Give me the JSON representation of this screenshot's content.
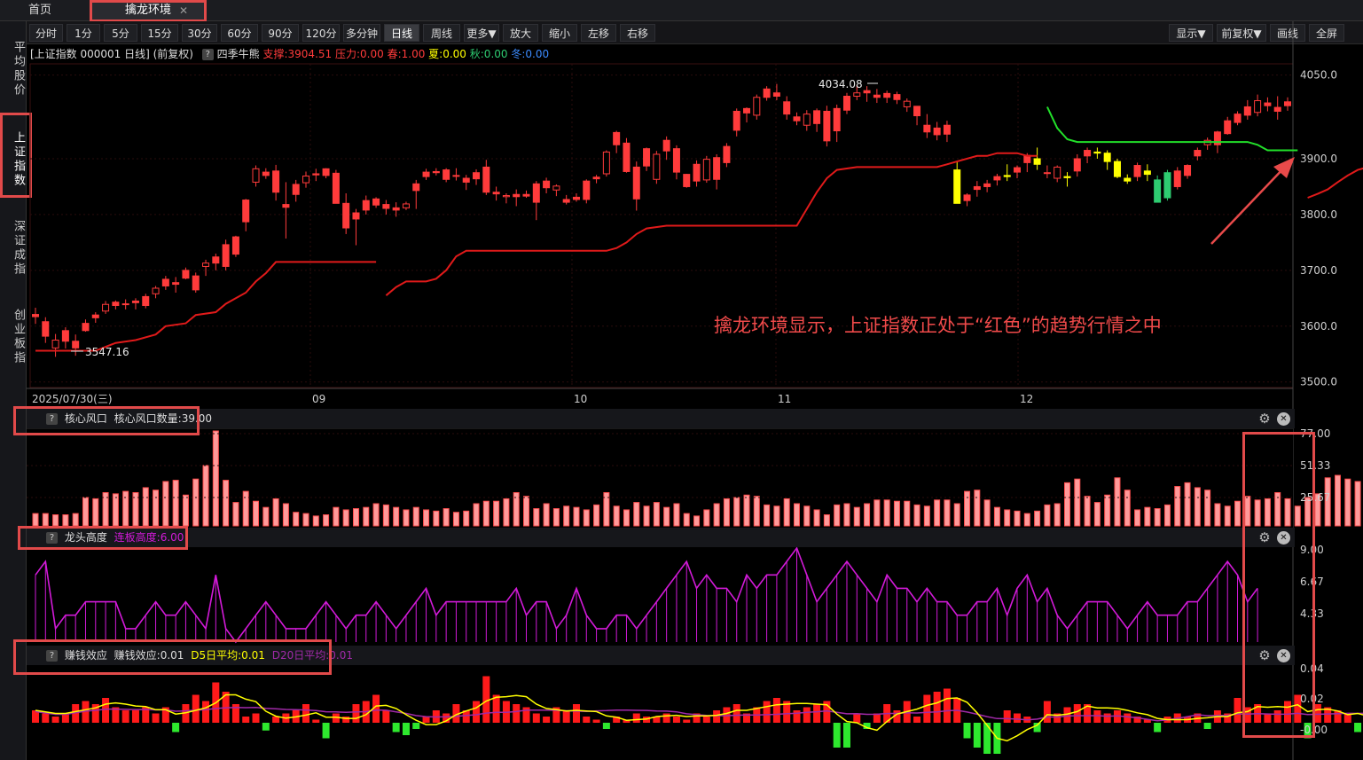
{
  "tabs": {
    "home": "首页",
    "active": "擒龙环境",
    "close": "✕"
  },
  "toolbar": {
    "left": [
      "分时",
      "1分",
      "5分",
      "15分",
      "30分",
      "60分",
      "90分",
      "120分",
      "多分钟",
      "日线",
      "周线",
      "更多▼",
      "放大",
      "缩小",
      "左移",
      "右移"
    ],
    "right": [
      "显示▼",
      "前复权▼",
      "画线",
      "全屏"
    ],
    "selected": "日线"
  },
  "sidebar": [
    "平均股价",
    "上证指数",
    "深证成指",
    "创业板指"
  ],
  "main_info": {
    "title": "[上证指数 000001 日线] (前复权)",
    "qmark": "?",
    "indicator": "四季牛熊",
    "support": "支撑:3904.51",
    "pressure": "压力:0.00",
    "spring": "春:1.00",
    "summer": "夏:0.00",
    "autumn": "秋:0.00",
    "winter": "冬:0.00"
  },
  "main_chart": {
    "y_ticks": [
      "4050.0",
      "3900.0",
      "3800.0",
      "3700.0",
      "3600.0",
      "3500.0"
    ],
    "high_label": "4034.08",
    "low_label": "3547.16",
    "date_label": "2025/07/30(三)",
    "month_labels": [
      "09",
      "10",
      "11",
      "12"
    ],
    "annotation": "擒龙环境显示，上证指数正处于“红色”的趋势行情之中"
  },
  "panels": {
    "core": {
      "qmark": "?",
      "name": "核心风口",
      "value": "核心风口数量:39.00",
      "ticks": [
        "77.00",
        "51.33",
        "25.67"
      ]
    },
    "dragon": {
      "qmark": "?",
      "name": "龙头高度",
      "value": "连板高度:6.00",
      "ticks": [
        "9.00",
        "6.67",
        "4.33"
      ]
    },
    "money": {
      "qmark": "?",
      "name": "赚钱效应",
      "value": "赚钱效应:0.01",
      "d5": "D5日平均:0.01",
      "d20": "D20日平均:0.01",
      "ticks": [
        "0.04",
        "0.02",
        "-0.00"
      ]
    }
  },
  "colors": {
    "up": "#ff3b3b",
    "down_yellow": "#ffff00",
    "down_green": "#2ecc71",
    "support_red": "#e01a1a",
    "support_green": "#22e02a",
    "bars_fill": "#ff9a9a",
    "bars_edge": "#ff4d4d",
    "magenta": "#d21ad8",
    "annot": "#f04a4a"
  },
  "chart_data": {
    "type": "candlestick",
    "ylim": [
      3490,
      4070
    ],
    "candles": [
      [
        3617,
        3633,
        3604,
        3621
      ],
      [
        3608,
        3616,
        3570,
        3582
      ],
      [
        3561,
        3586,
        3545,
        3575
      ],
      [
        3573,
        3598,
        3560,
        3592
      ],
      [
        3573,
        3585,
        3547,
        3561
      ],
      [
        3592,
        3612,
        3590,
        3605
      ],
      [
        3615,
        3625,
        3606,
        3620
      ],
      [
        3627,
        3645,
        3622,
        3639
      ],
      [
        3637,
        3646,
        3630,
        3643
      ],
      [
        3640,
        3648,
        3630,
        3640
      ],
      [
        3642,
        3650,
        3630,
        3645
      ],
      [
        3637,
        3658,
        3632,
        3653
      ],
      [
        3658,
        3672,
        3650,
        3668
      ],
      [
        3672,
        3690,
        3665,
        3684
      ],
      [
        3675,
        3688,
        3660,
        3678
      ],
      [
        3686,
        3705,
        3684,
        3700
      ],
      [
        3665,
        3696,
        3660,
        3690
      ],
      [
        3707,
        3719,
        3690,
        3713
      ],
      [
        3713,
        3730,
        3700,
        3724
      ],
      [
        3707,
        3755,
        3700,
        3746
      ],
      [
        3729,
        3762,
        3724,
        3760
      ],
      [
        3787,
        3828,
        3770,
        3826
      ],
      [
        3858,
        3888,
        3850,
        3882
      ],
      [
        3870,
        3883,
        3864,
        3876
      ],
      [
        3840,
        3889,
        3825,
        3878
      ],
      [
        3813,
        3858,
        3757,
        3818
      ],
      [
        3836,
        3862,
        3823,
        3854
      ],
      [
        3857,
        3877,
        3848,
        3869
      ],
      [
        3871,
        3882,
        3860,
        3873
      ],
      [
        3870,
        3883,
        3865,
        3882
      ],
      [
        3874,
        3880,
        3820,
        3820
      ],
      [
        3820,
        3838,
        3765,
        3776
      ],
      [
        3803,
        3810,
        3745,
        3792
      ],
      [
        3808,
        3834,
        3800,
        3825
      ],
      [
        3817,
        3831,
        3812,
        3828
      ],
      [
        3811,
        3826,
        3800,
        3818
      ],
      [
        3808,
        3822,
        3796,
        3812
      ],
      [
        3812,
        3823,
        3808,
        3819
      ],
      [
        3843,
        3862,
        3810,
        3855
      ],
      [
        3868,
        3882,
        3862,
        3876
      ],
      [
        3875,
        3883,
        3870,
        3877
      ],
      [
        3863,
        3883,
        3858,
        3880
      ],
      [
        3870,
        3883,
        3861,
        3869
      ],
      [
        3858,
        3871,
        3844,
        3865
      ],
      [
        3864,
        3881,
        3853,
        3875
      ],
      [
        3885,
        3898,
        3835,
        3840
      ],
      [
        3837,
        3850,
        3825,
        3840
      ],
      [
        3832,
        3838,
        3820,
        3834
      ],
      [
        3832,
        3845,
        3815,
        3836
      ],
      [
        3833,
        3843,
        3830,
        3836
      ],
      [
        3822,
        3860,
        3790,
        3855
      ],
      [
        3848,
        3866,
        3838,
        3860
      ],
      [
        3844,
        3854,
        3833,
        3851
      ],
      [
        3827,
        3835,
        3818,
        3822
      ],
      [
        3827,
        3838,
        3823,
        3831
      ],
      [
        3827,
        3863,
        3820,
        3860
      ],
      [
        3864,
        3871,
        3856,
        3867
      ],
      [
        3873,
        3915,
        3868,
        3912
      ],
      [
        3925,
        3950,
        3910,
        3947
      ],
      [
        3877,
        3937,
        3875,
        3928
      ],
      [
        3828,
        3895,
        3807,
        3885
      ],
      [
        3887,
        3920,
        3878,
        3918
      ],
      [
        3863,
        3914,
        3855,
        3908
      ],
      [
        3914,
        3940,
        3898,
        3933
      ],
      [
        3876,
        3924,
        3863,
        3918
      ],
      [
        3850,
        3873,
        3848,
        3872
      ],
      [
        3860,
        3897,
        3850,
        3890
      ],
      [
        3862,
        3905,
        3857,
        3899
      ],
      [
        3863,
        3908,
        3845,
        3902
      ],
      [
        3893,
        3928,
        3885,
        3922
      ],
      [
        3951,
        3990,
        3940,
        3985
      ],
      [
        3982,
        3992,
        3965,
        3990
      ],
      [
        3978,
        4015,
        3970,
        4010
      ],
      [
        4010,
        4030,
        4004,
        4025
      ],
      [
        4018,
        4034,
        4005,
        4012
      ],
      [
        4002,
        4012,
        3970,
        3980
      ],
      [
        3968,
        3983,
        3960,
        3975
      ],
      [
        3960,
        3987,
        3950,
        3980
      ],
      [
        3963,
        3990,
        3948,
        3986
      ],
      [
        3932,
        3995,
        3922,
        3985
      ],
      [
        3950,
        3997,
        3930,
        3990
      ],
      [
        3987,
        4018,
        3980,
        4012
      ],
      [
        4012,
        4032,
        4005,
        4018
      ],
      [
        4018,
        4030,
        4002,
        4022
      ],
      [
        4014,
        4025,
        4000,
        4010
      ],
      [
        4010,
        4022,
        4000,
        4017
      ],
      [
        4006,
        4020,
        3998,
        4015
      ],
      [
        3993,
        4008,
        3984,
        4003
      ],
      [
        3977,
        3994,
        3960,
        3994
      ],
      [
        3948,
        3980,
        3937,
        3960
      ],
      [
        3955,
        3966,
        3933,
        3943
      ],
      [
        3944,
        3968,
        3930,
        3960
      ],
      [
        3880,
        3895,
        3820,
        3820
      ],
      [
        3825,
        3838,
        3815,
        3835
      ],
      [
        3845,
        3860,
        3832,
        3850
      ],
      [
        3850,
        3862,
        3840,
        3855
      ],
      [
        3862,
        3873,
        3852,
        3868
      ],
      [
        3870,
        3890,
        3860,
        3868
      ],
      [
        3876,
        3888,
        3865,
        3884
      ],
      [
        3893,
        3910,
        3876,
        3906
      ],
      [
        3900,
        3920,
        3880,
        3890
      ],
      [
        3875,
        3888,
        3865,
        3875
      ],
      [
        3865,
        3888,
        3858,
        3885
      ],
      [
        3868,
        3876,
        3850,
        3866
      ],
      [
        3878,
        3908,
        3868,
        3900
      ],
      [
        3905,
        3920,
        3892,
        3915
      ],
      [
        3912,
        3920,
        3900,
        3910
      ],
      [
        3910,
        3915,
        3880,
        3895
      ],
      [
        3895,
        3900,
        3865,
        3868
      ],
      [
        3865,
        3872,
        3855,
        3860
      ],
      [
        3868,
        3893,
        3860,
        3888
      ],
      [
        3878,
        3890,
        3860,
        3872
      ],
      [
        3862,
        3870,
        3822,
        3822
      ],
      [
        3830,
        3880,
        3825,
        3875
      ],
      [
        3850,
        3885,
        3845,
        3878
      ],
      [
        3870,
        3890,
        3864,
        3888
      ],
      [
        3905,
        3920,
        3897,
        3915
      ],
      [
        3925,
        3938,
        3916,
        3933
      ],
      [
        3925,
        3950,
        3910,
        3948
      ],
      [
        3945,
        3975,
        3943,
        3968
      ],
      [
        3965,
        3985,
        3960,
        3980
      ],
      [
        3978,
        4005,
        3970,
        3993
      ],
      [
        3983,
        4015,
        3976,
        4004
      ],
      [
        3995,
        4010,
        3985,
        4000
      ],
      [
        3992,
        4012,
        3970,
        3985
      ],
      [
        3995,
        4010,
        3986,
        4002
      ]
    ],
    "support_series": [
      [
        0,
        3555
      ],
      [
        9,
        3555
      ],
      [
        11,
        3565
      ],
      [
        14,
        3580
      ],
      [
        17,
        3610
      ],
      [
        20,
        3630
      ],
      [
        23,
        3660
      ],
      [
        25,
        3690
      ],
      [
        26,
        3700
      ],
      [
        28,
        3715
      ],
      [
        30,
        3715
      ],
      [
        32,
        3715
      ],
      [
        34,
        3700
      ],
      [
        35,
        3700
      ],
      [
        38,
        3720
      ],
      [
        41,
        3745
      ],
      [
        43,
        3770
      ],
      [
        47,
        3770
      ],
      [
        50,
        3775
      ],
      [
        53,
        3775
      ],
      [
        56,
        3780
      ],
      [
        59,
        3790
      ],
      [
        61,
        3795
      ],
      [
        63,
        3810
      ],
      [
        65,
        3830
      ],
      [
        68,
        3860
      ],
      [
        70,
        3880
      ],
      [
        73,
        3885
      ],
      [
        76,
        3885
      ],
      [
        79,
        3885
      ],
      [
        82,
        3895
      ],
      [
        85,
        3900
      ],
      [
        87,
        3905
      ],
      [
        90,
        3910
      ],
      [
        93,
        3910
      ],
      [
        96,
        3920
      ],
      [
        99,
        3930
      ],
      [
        101,
        3935
      ],
      [
        104,
        3935
      ],
      [
        107,
        3935
      ],
      [
        110,
        3930
      ],
      [
        113,
        3930
      ],
      [
        116,
        3910
      ],
      [
        119,
        3905
      ],
      [
        121,
        3905
      ],
      [
        124,
        3920
      ],
      [
        127,
        3945
      ],
      [
        130,
        3955
      ],
      [
        133,
        3960
      ],
      [
        136,
        3975
      ]
    ],
    "support_green_from": 103,
    "support_green_to": 121,
    "candle_colors": "up red / down yellow after idx 34 / green when bearish in late range",
    "core_values": [
      10,
      10,
      9,
      9,
      10,
      23,
      22,
      27,
      26,
      28,
      27,
      31,
      29,
      36,
      37,
      25,
      38,
      49,
      77,
      37,
      19,
      28,
      20,
      15,
      22,
      18,
      11,
      10,
      8,
      9,
      15,
      13,
      14,
      15,
      18,
      17,
      15,
      13,
      15,
      13,
      12,
      14,
      11,
      12,
      18,
      20,
      20,
      22,
      27,
      24,
      14,
      18,
      14,
      16,
      15,
      13,
      17,
      27,
      16,
      13,
      19,
      16,
      19,
      15,
      18,
      10,
      8,
      13,
      18,
      22,
      23,
      25,
      24,
      17,
      16,
      22,
      18,
      16,
      13,
      9,
      17,
      18,
      15,
      18,
      21,
      21,
      20,
      20,
      17,
      16,
      21,
      21,
      18,
      28,
      29,
      21,
      15,
      13,
      12,
      10,
      12,
      17,
      18,
      35,
      38,
      24,
      19,
      25,
      39,
      29,
      13,
      15,
      14,
      17,
      32,
      35,
      31,
      29,
      18,
      16,
      20,
      24,
      21,
      22,
      27,
      22,
      16,
      23,
      26,
      39,
      41,
      38,
      36
    ]
  }
}
